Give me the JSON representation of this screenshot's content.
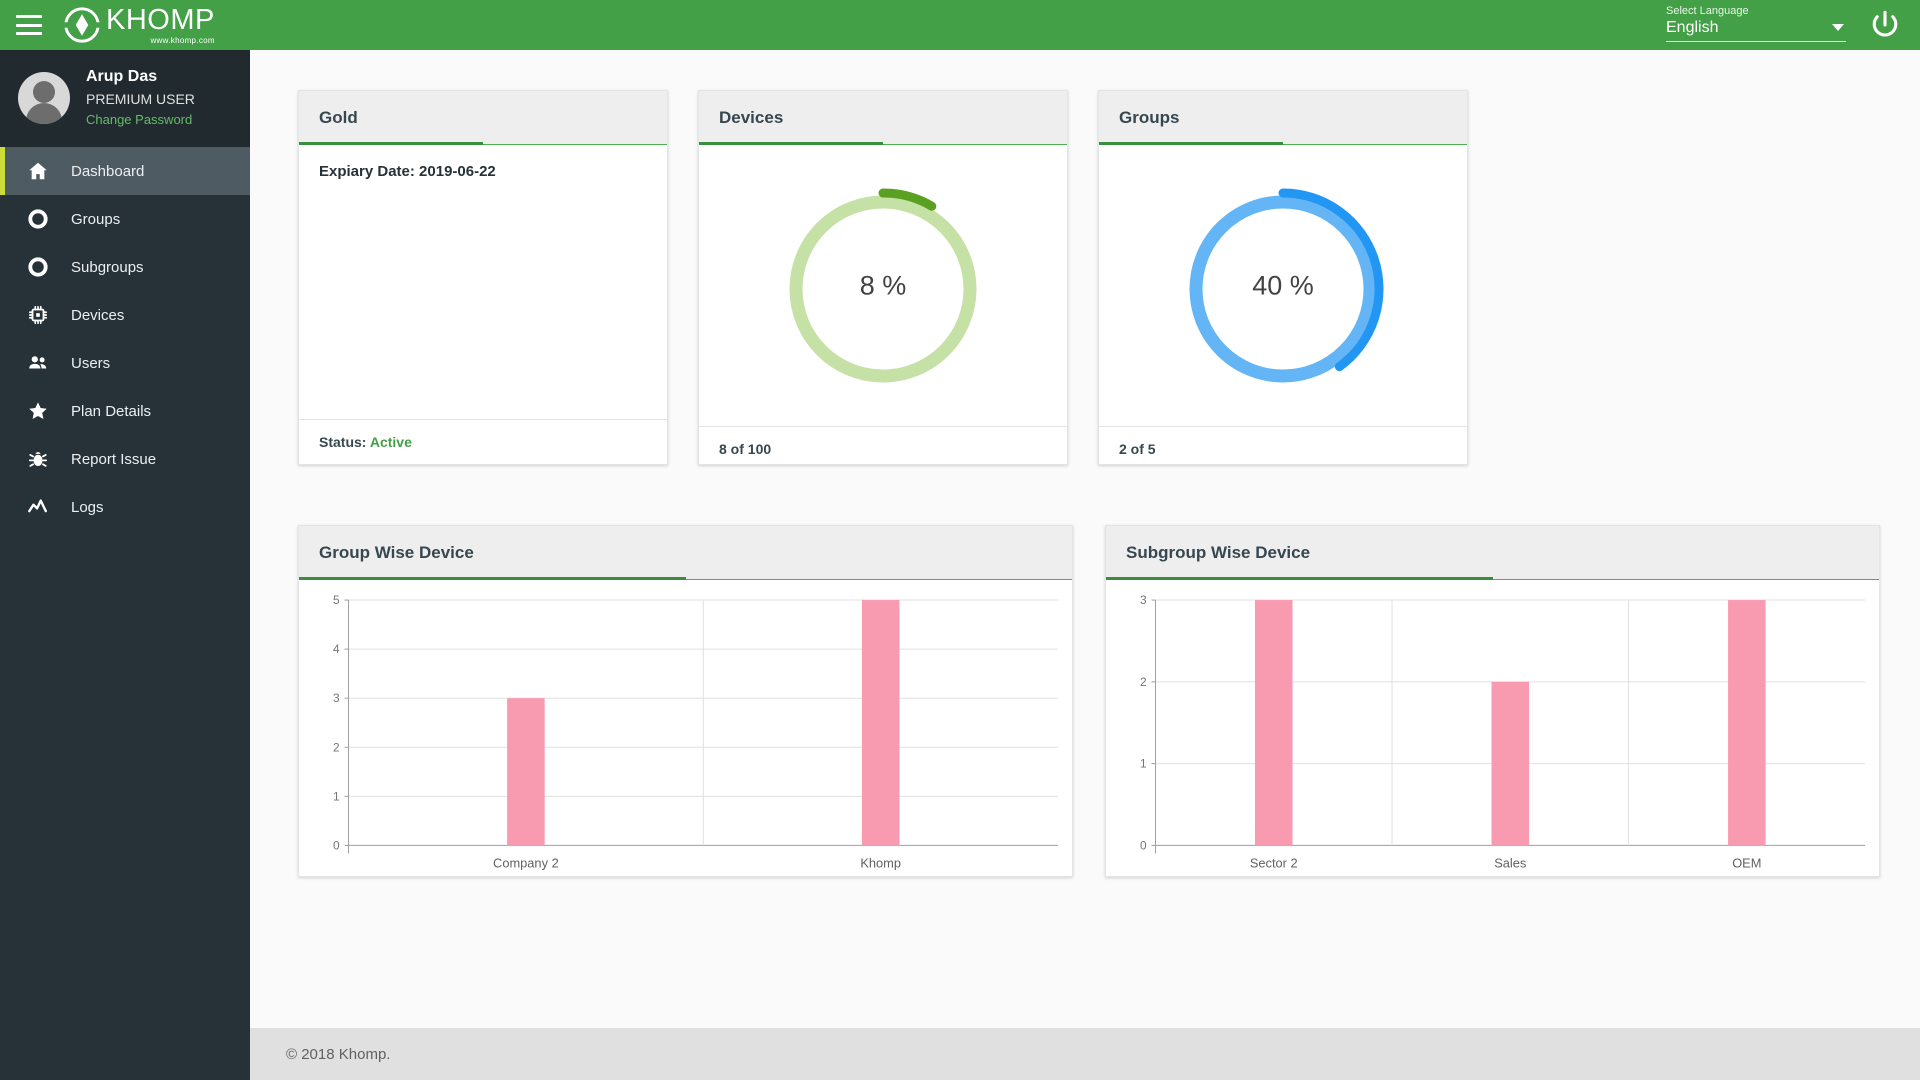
{
  "topbar": {
    "menu_icon": "hamburger-icon",
    "brand_name": "KHOMP",
    "brand_url": "www.khomp.com",
    "language_label": "Select Language",
    "language_value": "English",
    "power_icon": "power-icon",
    "accent_color": "#43a047"
  },
  "sidebar": {
    "profile": {
      "name": "Arup Das",
      "role": "PREMIUM USER",
      "change_password": "Change Password"
    },
    "items": [
      {
        "label": "Dashboard",
        "icon": "home-icon",
        "active": true
      },
      {
        "label": "Groups",
        "icon": "circle-icon",
        "active": false
      },
      {
        "label": "Subgroups",
        "icon": "circle-icon",
        "active": false
      },
      {
        "label": "Devices",
        "icon": "chip-icon",
        "active": false
      },
      {
        "label": "Users",
        "icon": "people-icon",
        "active": false
      },
      {
        "label": "Plan Details",
        "icon": "star-icon",
        "active": false
      },
      {
        "label": "Report Issue",
        "icon": "bug-icon",
        "active": false
      },
      {
        "label": "Logs",
        "icon": "trending-icon",
        "active": false
      }
    ],
    "active_accent": "#cddc39"
  },
  "cards": {
    "gold": {
      "title": "Gold",
      "expiry": "Expiary Date: 2019-06-22",
      "status_label": "Status: ",
      "status_value": "Active",
      "status_color": "#43a047"
    },
    "devices": {
      "title": "Devices",
      "percent_text": "8 %",
      "footer": "8 of 100",
      "track_color": "#c5e1a5",
      "arc_color": "#5aa021"
    },
    "groups": {
      "title": "Groups",
      "percent_text": "40 %",
      "footer": "2 of 5",
      "track_color": "#64b5f6",
      "arc_color": "#2196f3"
    }
  },
  "chart_data": [
    {
      "type": "bar",
      "title": "Group Wise Device",
      "categories": [
        "Company 2",
        "Khomp"
      ],
      "values": [
        3,
        5
      ],
      "xlabel": "",
      "ylabel": "",
      "ylim": [
        0,
        5
      ],
      "yticks": [
        0,
        1,
        2,
        3,
        4,
        5
      ],
      "grid": true,
      "legend": "none",
      "bar_color": "#f99bb0"
    },
    {
      "type": "bar",
      "title": "Subgroup Wise Device",
      "categories": [
        "Sector 2",
        "Sales",
        "OEM"
      ],
      "values": [
        3,
        2,
        3
      ],
      "xlabel": "",
      "ylabel": "",
      "ylim": [
        0,
        3
      ],
      "yticks": [
        0,
        1,
        2,
        3
      ],
      "grid": true,
      "legend": "none",
      "bar_color": "#f99bb0"
    }
  ],
  "footer": {
    "copyright": "© 2018 Khomp."
  }
}
